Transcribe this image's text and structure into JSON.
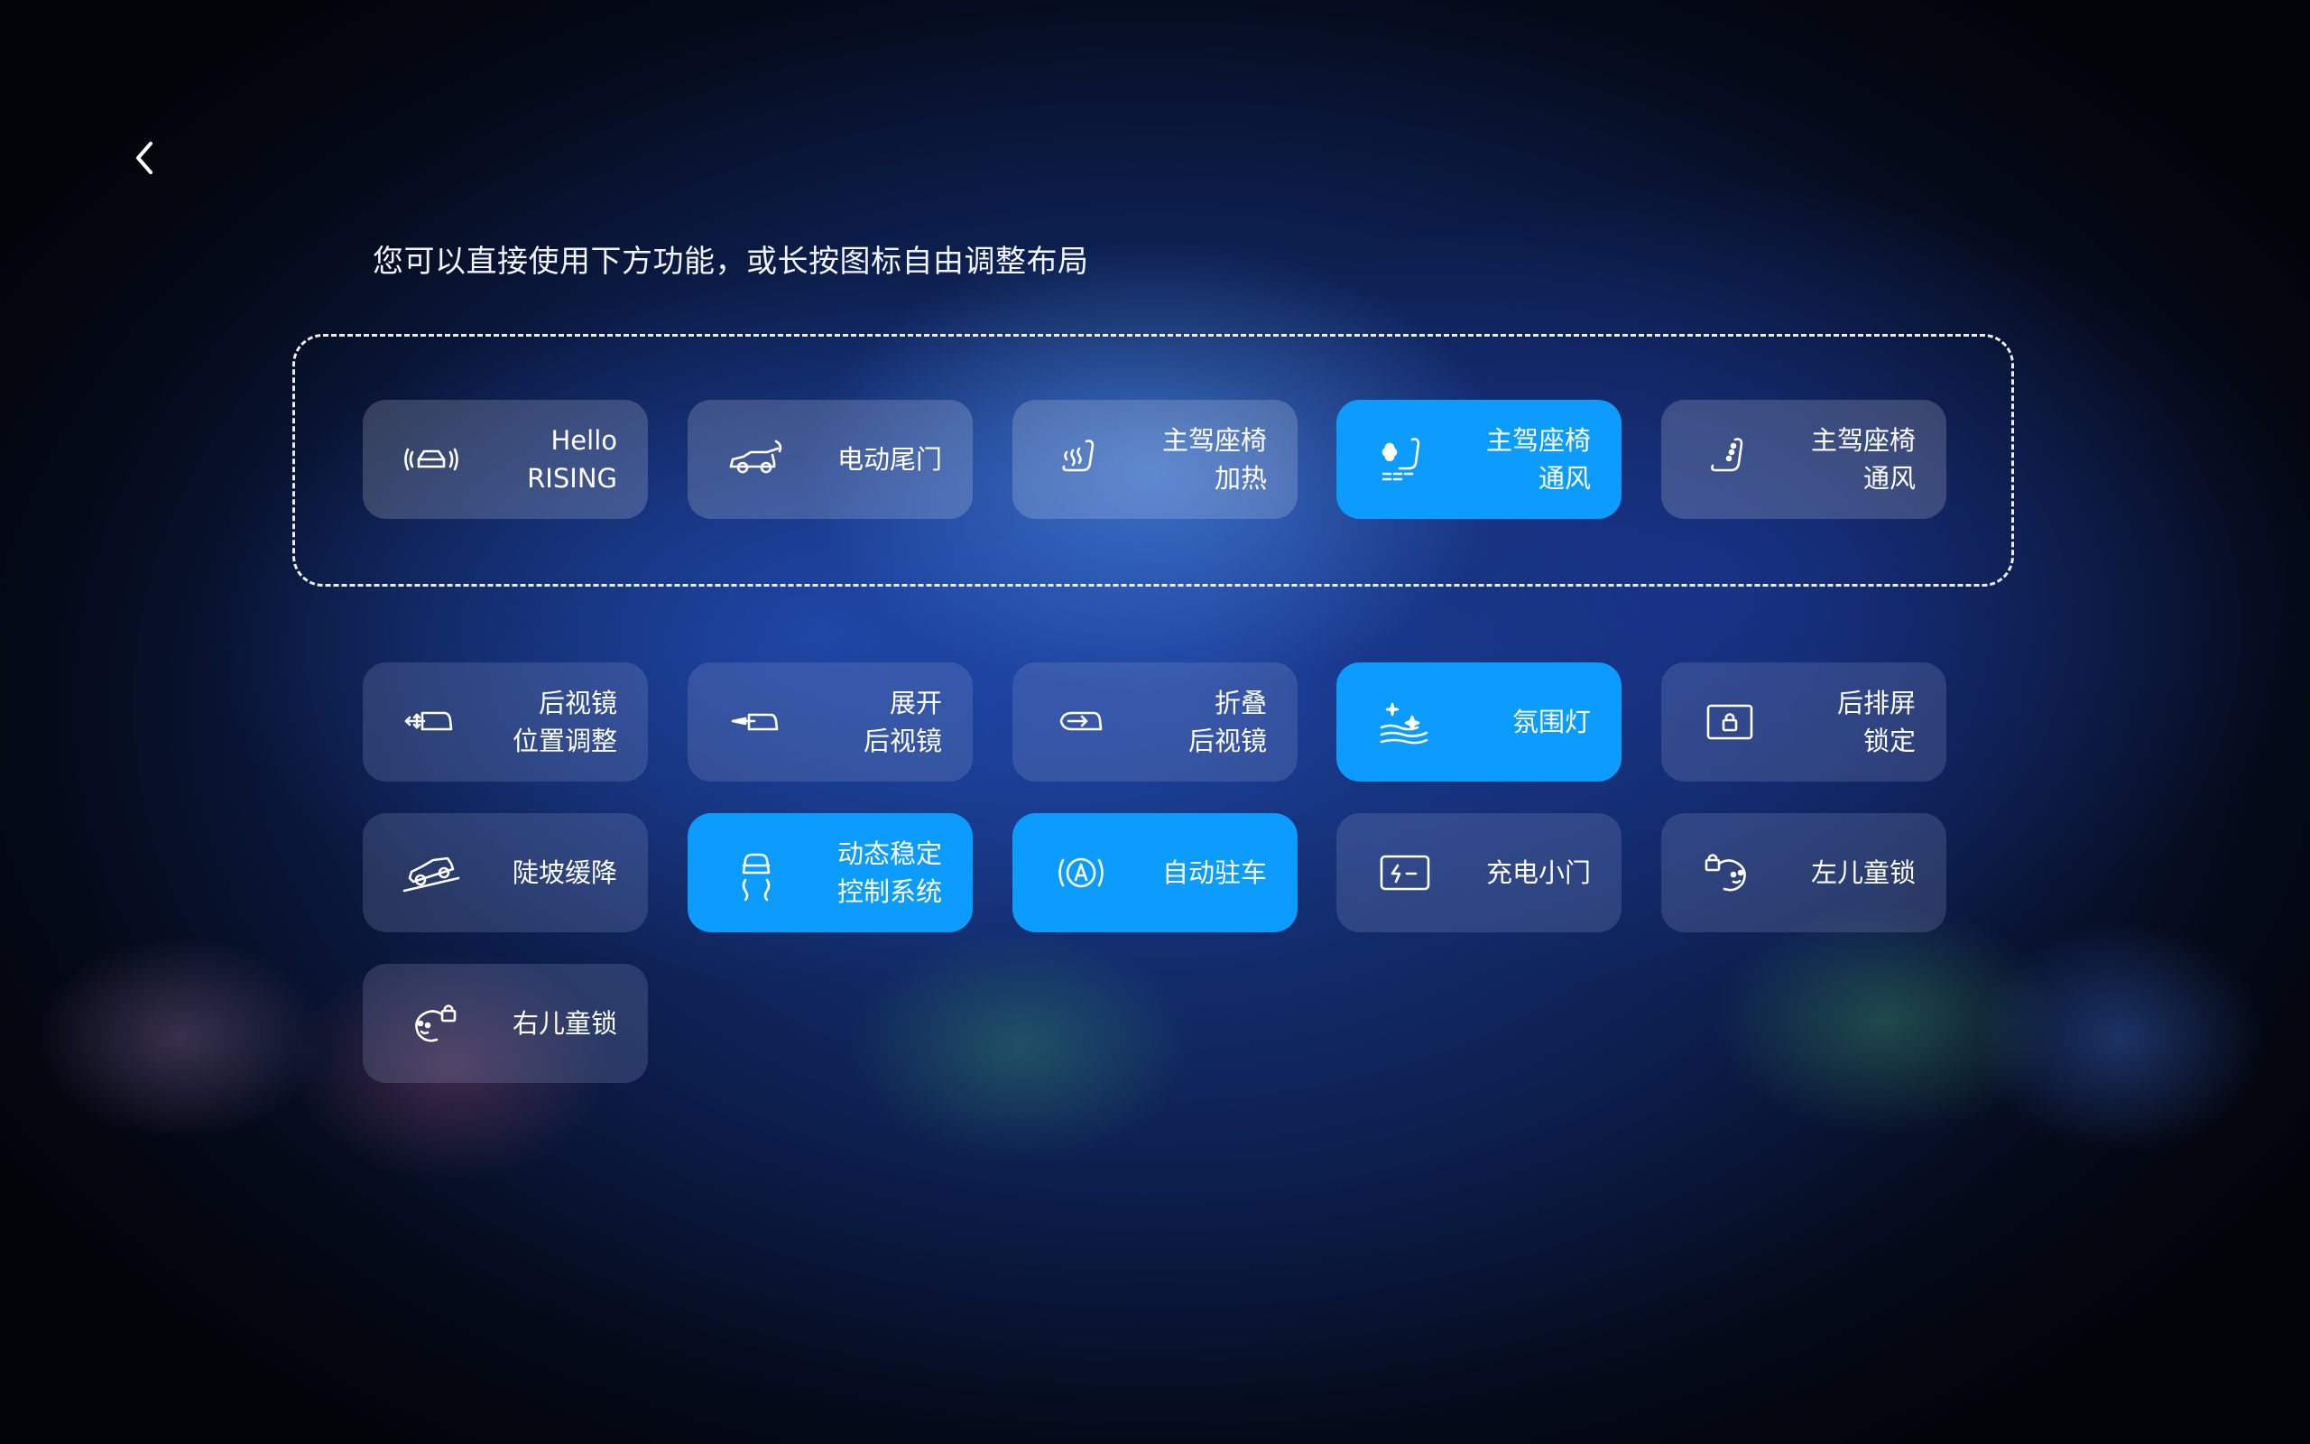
{
  "hint_text": "您可以直接使用下方功能，或长按图标自由调整布局",
  "colors": {
    "active_tile": "#0c9cff",
    "tile": "rgba(255,255,255,0.18)"
  },
  "pinned": [
    {
      "icon": "hello-rising-icon",
      "line1": "Hello",
      "line2": "RISING",
      "active": false
    },
    {
      "icon": "power-tailgate-icon",
      "line1": "电动尾门",
      "line2": "",
      "active": false
    },
    {
      "icon": "seat-heating-icon",
      "line1": "主驾座椅",
      "line2": "加热",
      "active": false
    },
    {
      "icon": "seat-ventilation-icon",
      "line1": "主驾座椅",
      "line2": "通风",
      "active": true
    },
    {
      "icon": "seat-ventilation-icon",
      "line1": "主驾座椅",
      "line2": "通风",
      "active": false
    }
  ],
  "functions": [
    {
      "icon": "mirror-adjust-icon",
      "line1": "后视镜",
      "line2": "位置调整",
      "active": false
    },
    {
      "icon": "mirror-unfold-icon",
      "line1": "展开",
      "line2": "后视镜",
      "active": false
    },
    {
      "icon": "mirror-fold-icon",
      "line1": "折叠",
      "line2": "后视镜",
      "active": false
    },
    {
      "icon": "ambient-light-icon",
      "line1": "氛围灯",
      "line2": "",
      "active": true
    },
    {
      "icon": "rear-screen-lock-icon",
      "line1": "后排屏",
      "line2": "锁定",
      "active": false
    },
    {
      "icon": "hill-descent-icon",
      "line1": "陡坡缓降",
      "line2": "",
      "active": false
    },
    {
      "icon": "stability-control-icon",
      "line1": "动态稳定",
      "line2": "控制系统",
      "active": true
    },
    {
      "icon": "auto-hold-icon",
      "line1": "自动驻车",
      "line2": "",
      "active": true
    },
    {
      "icon": "charge-port-icon",
      "line1": "充电小门",
      "line2": "",
      "active": false
    },
    {
      "icon": "left-child-lock-icon",
      "line1": "左儿童锁",
      "line2": "",
      "active": false
    },
    {
      "icon": "right-child-lock-icon",
      "line1": "右儿童锁",
      "line2": "",
      "active": false
    }
  ]
}
